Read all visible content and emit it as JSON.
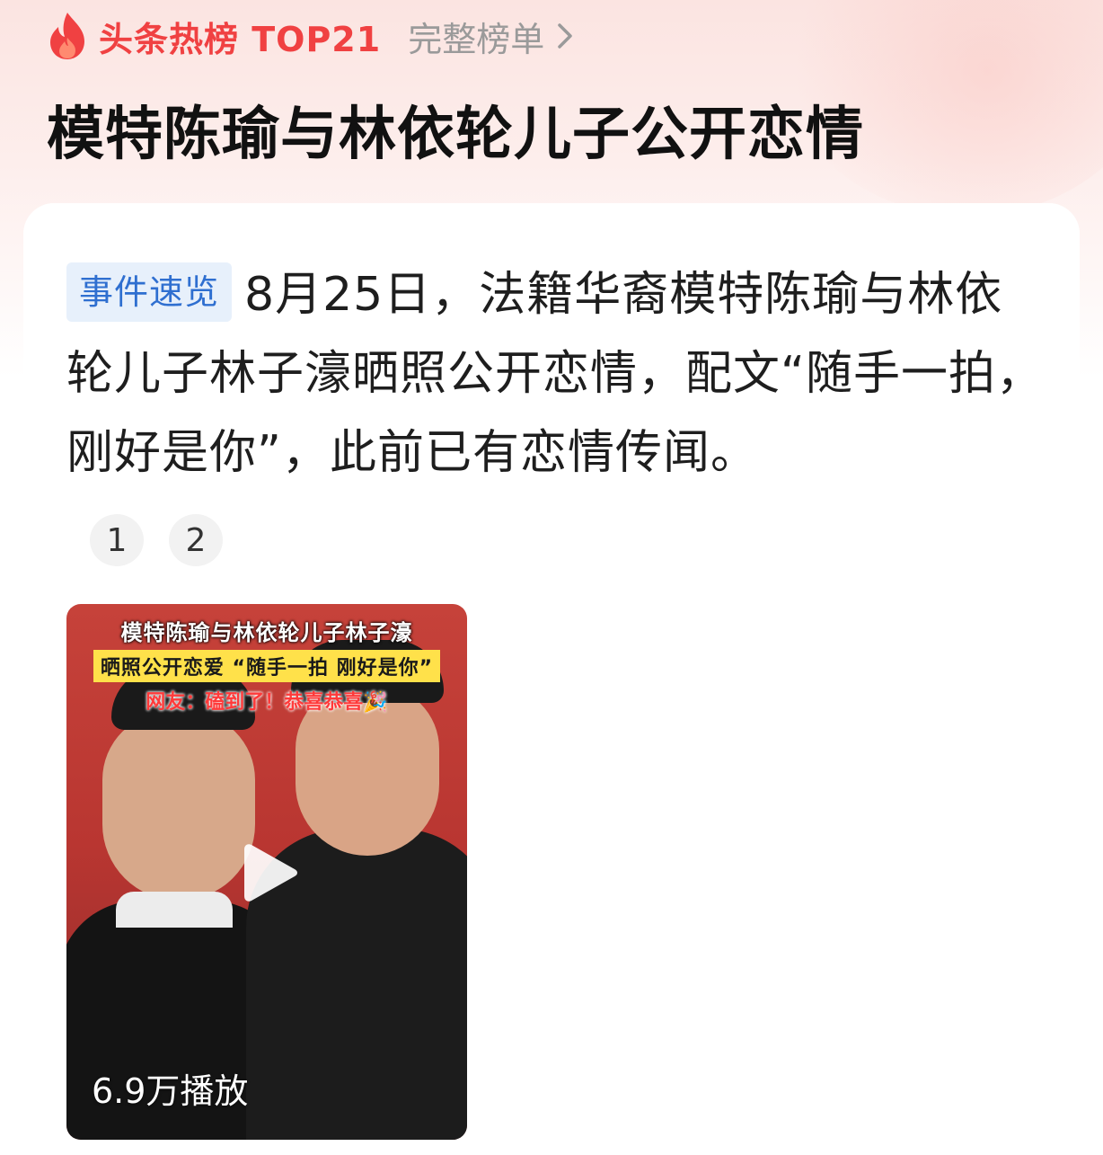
{
  "header": {
    "hot_label": "头条热榜 TOP21",
    "full_list_label": "完整榜单",
    "accent_color": "#f04142"
  },
  "headline": "模特陈瑜与林依轮儿子公开恋情",
  "summary": {
    "tag": "事件速览",
    "text": "8月25日，法籍华裔模特陈瑜与林依轮儿子林子濠晒照公开恋情，配文“随手一拍，刚好是你”，此前已有恋情传闻。"
  },
  "pager": {
    "pages": [
      "1",
      "2"
    ]
  },
  "video": {
    "caption_line1": "模特陈瑜与林依轮儿子林子濠",
    "caption_line2": "晒照公开恋爱 “随手一拍 刚好是你”",
    "caption_line3": "网友：磕到了！恭喜恭喜🎉",
    "play_count": "6.9万播放"
  }
}
